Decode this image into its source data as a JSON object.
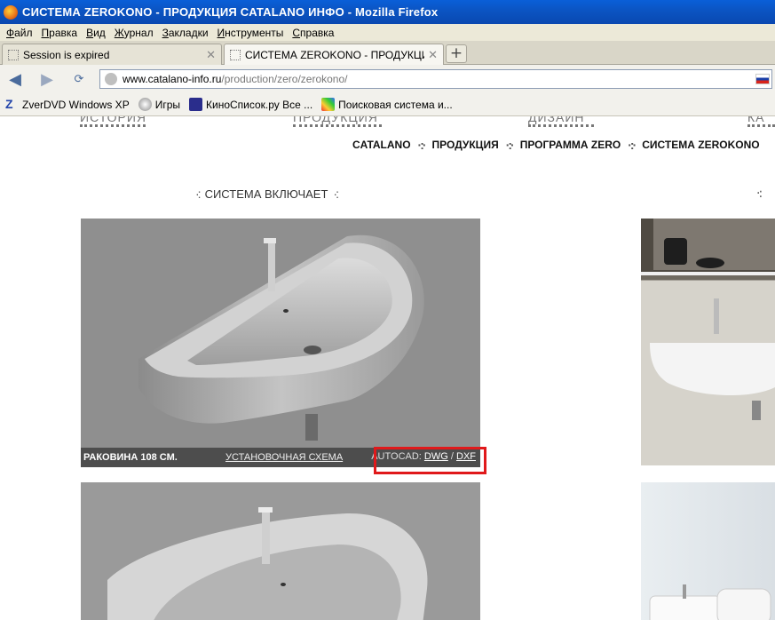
{
  "window": {
    "title": "СИСТЕМА ZEROKONO - ПРОДУКЦИЯ CATALANO ИНФО - Mozilla Firefox"
  },
  "menu": [
    "Файл",
    "Правка",
    "Вид",
    "Журнал",
    "Закладки",
    "Инструменты",
    "Справка"
  ],
  "tabs": [
    {
      "label": "Session is expired",
      "active": false
    },
    {
      "label": "СИСТЕМА ZEROKONO - ПРОДУКЦИЯ С...",
      "active": true
    }
  ],
  "url": {
    "host": "www.catalano-info.ru",
    "path": "/production/zero/zerokono/"
  },
  "bookmarks": [
    {
      "label": "ZverDVD Windows XP",
      "icon": "zverdvd-icon"
    },
    {
      "label": "Игры",
      "icon": "games-icon"
    },
    {
      "label": "КиноСписок.ру Все ...",
      "icon": "kino-icon"
    },
    {
      "label": "Поисковая система и...",
      "icon": "search-engine-icon"
    }
  ],
  "page": {
    "ghost_nav": [
      "ИСТОРИЯ",
      "ПРОДУКЦИЯ",
      "ДИЗАЙН",
      "КА"
    ],
    "breadcrumbs": [
      "CATALANO",
      "ПРОДУКЦИЯ",
      "ПРОГРАММА ZERO",
      "СИСТЕМА ZEROKONO"
    ],
    "section_title": "СИСТЕМА ВКЛЮЧАЕТ",
    "product1": {
      "title": "РАКОВИНА 108 СМ.",
      "schema_link": "УСТАНОВОЧНАЯ СХЕМА",
      "autocad_label": "AUTOCAD:",
      "dwg": "DWG",
      "slash": "/",
      "dxf": "DXF"
    }
  }
}
